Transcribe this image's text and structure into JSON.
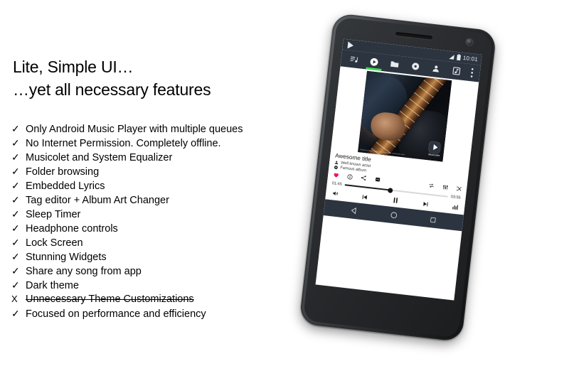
{
  "slide": {
    "headline_line1": "Lite, Simple UI…",
    "headline_line2": "…yet all necessary features",
    "features": [
      {
        "marker": "✓",
        "text": "Only Android Music Player with multiple queues",
        "struck": false
      },
      {
        "marker": "✓",
        "text": "No Internet Permission. Completely offline.",
        "struck": false
      },
      {
        "marker": "✓",
        "text": "Musicolet and System Equalizer",
        "struck": false
      },
      {
        "marker": "✓",
        "text": "Folder browsing",
        "struck": false
      },
      {
        "marker": "✓",
        "text": "Embedded Lyrics",
        "struck": false
      },
      {
        "marker": "✓",
        "text": "Tag editor + Album Art Changer",
        "struck": false
      },
      {
        "marker": "✓",
        "text": "Sleep Timer",
        "struck": false
      },
      {
        "marker": "✓",
        "text": "Headphone controls",
        "struck": false
      },
      {
        "marker": "✓",
        "text": "Lock Screen",
        "struck": false
      },
      {
        "marker": "✓",
        "text": "Stunning Widgets",
        "struck": false
      },
      {
        "marker": "✓",
        "text": "Share any song from app",
        "struck": false
      },
      {
        "marker": "✓",
        "text": "Dark theme",
        "struck": false
      },
      {
        "marker": "X",
        "text": "Unnecessary Theme Customizations",
        "struck": true
      },
      {
        "marker": "✓",
        "text": "Focused on performance and efficiency",
        "struck": false
      }
    ]
  },
  "phone": {
    "status_bar": {
      "clock": "10:01",
      "app_logo_icon": "play-triangle-icon",
      "signal_icon": "signal-bars-icon",
      "battery_icon": "battery-icon"
    },
    "tabs": [
      {
        "name": "queue",
        "icon": "queue-list-icon",
        "active": false
      },
      {
        "name": "now-playing",
        "icon": "play-circle-icon",
        "active": true
      },
      {
        "name": "folders",
        "icon": "folder-icon",
        "active": false
      },
      {
        "name": "albums",
        "icon": "disc-icon",
        "active": false
      },
      {
        "name": "artists",
        "icon": "person-icon",
        "active": false
      },
      {
        "name": "genres",
        "icon": "music-note-box-icon",
        "active": false
      },
      {
        "name": "overflow",
        "icon": "more-vertical-icon",
        "active": false
      }
    ],
    "album_art": {
      "caption": "Photo by Bruce Mars on Unsplash / musicolet.com",
      "watermark_label": "Musicolet",
      "watermark_icon": "musicolet-logo-icon"
    },
    "track": {
      "title": "Awesome title",
      "artist": "Well known artist",
      "artist_icon": "person-icon",
      "album": "Famous album",
      "album_icon": "disc-icon"
    },
    "actions_left": [
      {
        "name": "favorite",
        "icon": "heart-icon",
        "color": "#ED1651"
      },
      {
        "name": "info",
        "icon": "info-circle-icon",
        "color": "#1b1b1b"
      },
      {
        "name": "share",
        "icon": "share-icon",
        "color": "#1b1b1b"
      },
      {
        "name": "lyrics",
        "icon": "lyrics-icon",
        "color": "#1b1b1b"
      }
    ],
    "actions_right": [
      {
        "name": "repeat",
        "icon": "repeat-icon",
        "color": "#1b1b1b"
      },
      {
        "name": "equalizer",
        "icon": "equalizer-icon",
        "color": "#1b1b1b"
      },
      {
        "name": "shuffle",
        "icon": "shuffle-icon",
        "color": "#1b1b1b"
      }
    ],
    "seek": {
      "elapsed": "01:45",
      "duration": "03:55",
      "progress_percent": 44
    },
    "transport": [
      {
        "name": "volume",
        "icon": "volume-icon"
      },
      {
        "name": "previous",
        "icon": "skip-previous-icon"
      },
      {
        "name": "pause",
        "icon": "pause-icon"
      },
      {
        "name": "next",
        "icon": "skip-next-icon"
      },
      {
        "name": "visualizer",
        "icon": "bar-visualizer-icon"
      }
    ],
    "nav_bar": [
      {
        "name": "back",
        "icon": "back-triangle-icon"
      },
      {
        "name": "home",
        "icon": "home-circle-icon"
      },
      {
        "name": "recents",
        "icon": "recents-square-icon"
      }
    ],
    "colors": {
      "chrome": "#2c3440",
      "accent_green": "#3ddc4a",
      "favorite_pink": "#ED1651"
    }
  }
}
